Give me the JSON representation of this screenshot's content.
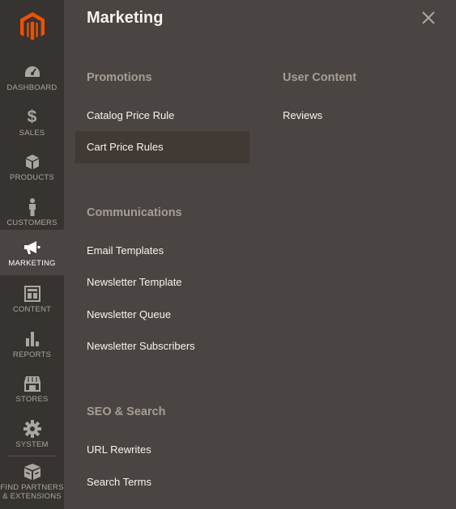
{
  "sidebar": {
    "items": [
      {
        "label": "DASHBOARD",
        "icon": "dashboard-icon"
      },
      {
        "label": "SALES",
        "icon": "dollar-icon"
      },
      {
        "label": "PRODUCTS",
        "icon": "box-icon"
      },
      {
        "label": "CUSTOMERS",
        "icon": "person-icon"
      },
      {
        "label": "MARKETING",
        "icon": "megaphone-icon"
      },
      {
        "label": "CONTENT",
        "icon": "layout-icon"
      },
      {
        "label": "REPORTS",
        "icon": "bar-chart-icon"
      },
      {
        "label": "STORES",
        "icon": "storefront-icon"
      },
      {
        "label": "SYSTEM",
        "icon": "gear-icon"
      }
    ],
    "partners": {
      "line1": "FIND PARTNERS",
      "line2": "& EXTENSIONS",
      "icon": "partners-box-icon"
    },
    "active": "MARKETING"
  },
  "panel": {
    "title": "Marketing",
    "sections": {
      "promotions": {
        "title": "Promotions",
        "links": [
          "Catalog Price Rule",
          "Cart Price Rules"
        ]
      },
      "communications": {
        "title": "Communications",
        "links": [
          "Email Templates",
          "Newsletter Template",
          "Newsletter Queue",
          "Newsletter Subscribers"
        ]
      },
      "seo": {
        "title": "SEO & Search",
        "links": [
          "URL Rewrites",
          "Search Terms"
        ]
      },
      "user_content": {
        "title": "User Content",
        "links": [
          "Reviews"
        ]
      }
    },
    "highlighted": "Cart Price Rules"
  },
  "colors": {
    "sidebar_bg": "#373330",
    "panel_bg": "#4a4542",
    "accent": "#eb5202",
    "section_title": "#a79d95",
    "link": "#f7f3eb"
  }
}
